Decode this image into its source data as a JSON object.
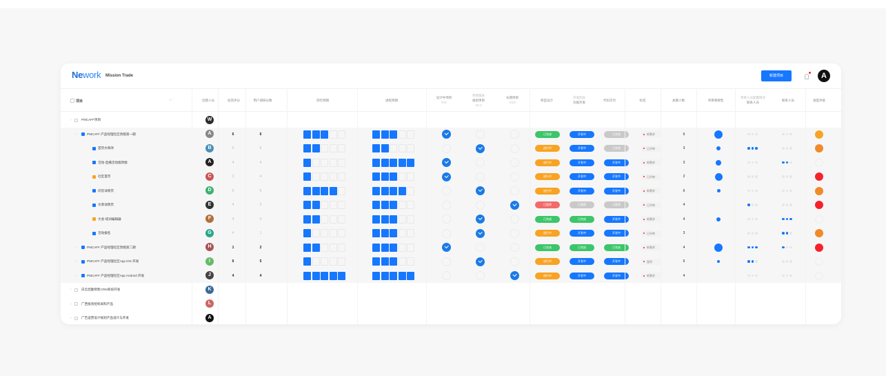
{
  "app": {
    "logo_a": "Ne",
    "logo_b": "work",
    "workspace": "Mission Trade"
  },
  "header": {
    "new_button": "新建项目",
    "avatar_letter": "A"
  },
  "colors": {
    "blue": "#1677ff",
    "green": "#3cc56a",
    "orange": "#f8a324",
    "red": "#f5222d",
    "grey": "#c9c9c9"
  },
  "table": {
    "title_header": "项目",
    "columns": [
      {
        "label": "创建人员"
      },
      {
        "label": "投资评分"
      },
      {
        "label": "用户调研分数"
      },
      {
        "label": "风险预期"
      },
      {
        "label": "进程预期"
      },
      {
        "label": "设计中项目",
        "sub": "P.O"
      },
      {
        "top": "项目版本",
        "label": "规划项目",
        "sub": "V2.3"
      },
      {
        "label": "长期项目",
        "sub": "V3.0"
      },
      {
        "label": "原型设计"
      },
      {
        "top": "开发阶段",
        "label": "功能开发"
      },
      {
        "label": "代码交付"
      },
      {
        "label": "标签"
      },
      {
        "label": "关键人数"
      },
      {
        "label": "项目重要性"
      },
      {
        "top": "项目人员配置情况",
        "label": "联系人员"
      },
      {
        "label": "联系人员"
      },
      {
        "label": "进度评级"
      }
    ]
  },
  "rows": [
    {
      "label": "PMCAFF项目",
      "expand": "›",
      "avatar": "W"
    },
    {
      "label": "PMCAFF 产品经理社区改版第一期",
      "expand": "›",
      "avatar": "A",
      "v1": "6",
      "v2": "6",
      "pill1": "已完成",
      "pill2": "开发中",
      "pill3": "已完成",
      "tag": "新需求",
      "key": "6"
    },
    {
      "label": "首页文章改",
      "avatar": "B",
      "v1": "5",
      "v2": "6",
      "pill1": "进行中",
      "pill2": "开发中",
      "pill3": "已完成",
      "tag": "已评审",
      "key": "3"
    },
    {
      "label": "活动-直播活动版改版",
      "avatar": "A",
      "v1": "4",
      "v2": "4",
      "pill1": "进行中",
      "pill2": "开发中",
      "pill3": "开发中",
      "tag": "新需求",
      "key": "3"
    },
    {
      "label": "社区首页",
      "avatar": "C",
      "v1": "3",
      "v2": "4",
      "pill1": "进行中",
      "pill2": "开发中",
      "pill3": "开发中",
      "tag": "已评审",
      "key": "2"
    },
    {
      "label": "问答详情页",
      "avatar": "D",
      "v1": "6",
      "v2": "6",
      "pill1": "进行中",
      "pill2": "开发中",
      "pill3": "开发中",
      "tag": "新需求",
      "key": "6"
    },
    {
      "label": "文章详情页",
      "avatar": "E",
      "v1": "4",
      "v2": "3",
      "pill1": "已暂停",
      "pill2": "已暂停",
      "pill3": "已暂停",
      "tag": "已评审",
      "key": "4"
    },
    {
      "label": "大会-培训编辑器",
      "avatar": "F",
      "v1": "4",
      "v2": "4",
      "pill1": "已完成",
      "pill2": "已完成",
      "pill3": "开发中",
      "tag": "新需求",
      "key": "4"
    },
    {
      "label": "活动报名",
      "avatar": "G",
      "v1": "4",
      "v2": "1",
      "pill1": "进行中",
      "pill2": "开发中",
      "pill3": "开发中",
      "tag": "已评审",
      "key": "3"
    },
    {
      "label": "PMCAFF 产品经理社区改版第二期",
      "expand": "›",
      "avatar": "H",
      "v1": "1",
      "v2": "2",
      "pill1": "已完成",
      "pill2": "已完成",
      "pill3": "已完成",
      "tag": "新需求",
      "key": "4"
    },
    {
      "label": "PMCAFF 产品经理社区App iOS 开发",
      "expand": "›",
      "avatar": "I",
      "v1": "6",
      "v2": "5",
      "pill1": "进行中",
      "pill2": "开发中",
      "pill3": "开发中",
      "tag": "暂停",
      "key": "6"
    },
    {
      "label": "PMCAFF 产品经理社区App Android 开发",
      "expand": "›",
      "avatar": "J",
      "v1": "4",
      "v2": "4",
      "pill1": "进行中",
      "pill2": "开发中",
      "pill3": "开发中",
      "tag": "新需求",
      "key": "4"
    },
    {
      "label": "白云后勤销售CRM系统开发",
      "expand": "›",
      "avatar": "K"
    },
    {
      "label": "广西投资招标采购产品",
      "expand": "›",
      "avatar": "L"
    },
    {
      "label": "广告运营设计规划产品设计与开发",
      "expand": "›",
      "avatar": "A"
    }
  ]
}
